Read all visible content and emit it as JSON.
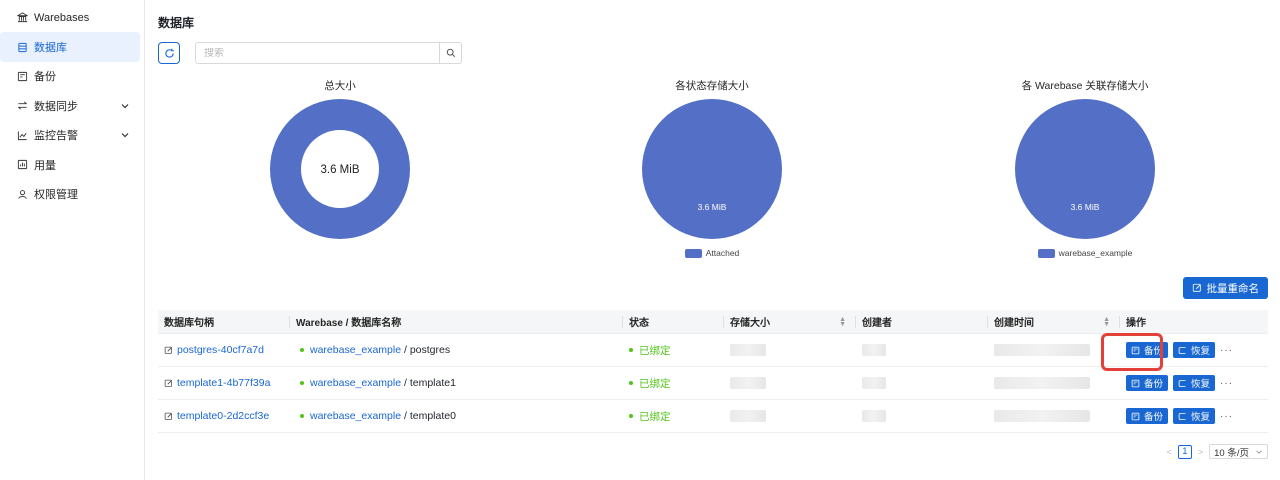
{
  "sidebar": {
    "items": [
      {
        "label": "Warebases",
        "icon": "bank-icon"
      },
      {
        "label": "数据库",
        "icon": "database-icon",
        "active": true
      },
      {
        "label": "备份",
        "icon": "backup-icon"
      },
      {
        "label": "数据同步",
        "icon": "sync-icon",
        "expandable": true
      },
      {
        "label": "监控告警",
        "icon": "chart-line-icon",
        "expandable": true
      },
      {
        "label": "用量",
        "icon": "usage-icon"
      },
      {
        "label": "权限管理",
        "icon": "user-icon"
      }
    ]
  },
  "header": {
    "title": "数据库"
  },
  "search": {
    "placeholder": "搜索"
  },
  "charts": [
    {
      "title": "总大小",
      "center_label": "3.6 MiB",
      "kind": "donut"
    },
    {
      "title": "各状态存储大小",
      "slice_label": "3.6 MiB",
      "legend": "Attached",
      "kind": "pie"
    },
    {
      "title": "各 Warebase 关联存储大小",
      "slice_label": "3.6 MiB",
      "legend": "warebase_example",
      "kind": "pie"
    }
  ],
  "chart_color": "#5470c6",
  "toolbar": {
    "rename_label": "批量重命名"
  },
  "table": {
    "headers": [
      "数据库句柄",
      "Warebase / 数据库名称",
      "状态",
      "存储大小",
      "创建者",
      "创建时间",
      "操作"
    ],
    "rows": [
      {
        "handle": "postgres-40cf7a7d",
        "warebase": "warebase_example",
        "dbname": "/ postgres",
        "status": "已绑定"
      },
      {
        "handle": "template1-4b77f39a",
        "warebase": "warebase_example",
        "dbname": "/ template1",
        "status": "已绑定"
      },
      {
        "handle": "template0-2d2ccf3e",
        "warebase": "warebase_example",
        "dbname": "/ template0",
        "status": "已绑定"
      }
    ],
    "backup_label": "备份",
    "restore_label": "恢复",
    "more_label": "···"
  },
  "pagination": {
    "current": "1",
    "page_size": "10 条/页"
  }
}
